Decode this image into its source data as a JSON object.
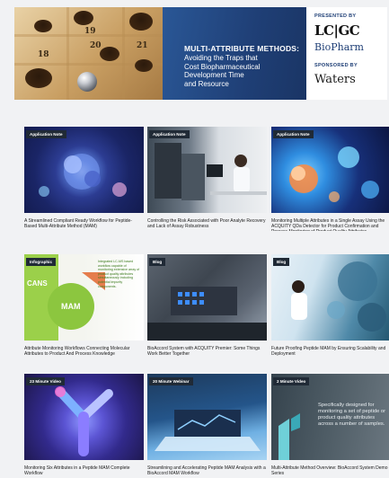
{
  "banner": {
    "title": "MULTI-ATTRIBUTE METHODS:",
    "subtitle_lines": [
      "Avoiding the Traps that",
      "Cost Biopharmaceutical",
      "Development Time",
      "and Resource"
    ],
    "presented_by": "PRESENTED BY",
    "logo_lcgc": "LC|GC",
    "logo_biopharm": "BioPharm",
    "sponsored_by": "SPONSORED BY",
    "logo_waters": "Waters",
    "board_numbers": [
      "19",
      "20",
      "21",
      "18"
    ]
  },
  "cards": [
    {
      "badge": "Application Note",
      "caption": "A Streamlined Compliant Ready Workflow for Peptide-Based Multi-Attribute Method (MAM)",
      "icon": "protein-structure-image"
    },
    {
      "badge": "Application Note",
      "caption": "Controlling the Risk Associated with Poor Analyte Recovery and Lack of Assay Robustness",
      "icon": "lab-scientist-image"
    },
    {
      "badge": "Application Note",
      "caption": "Monitoring Multiple Attributes in a Single Assay Using the ACQUITY QDa Detector for Product Confirmation and Process Monitoring of Product Quality Attributes",
      "icon": "molecules-image"
    },
    {
      "badge": "Infographic",
      "caption": "Attribute Monitoring Workflows Connecting Molecular Attributes to Product And Process Knowledge",
      "icon": "mam-infographic-image"
    },
    {
      "badge": "Blog",
      "caption": "BioAccord System with ACQUITY Premier: Some Things Work Better Together",
      "icon": "instrument-image"
    },
    {
      "badge": "Blog",
      "caption": "Future Proofing Peptide MAM by Ensuring Scalability and Deployment",
      "icon": "scientist-cells-image"
    },
    {
      "badge": "23 Minute Video",
      "caption": "Monitoring Six Attributes in a Peptide MAM Complete Workflow",
      "icon": "antibody-image"
    },
    {
      "badge": "20 Minute Webinar",
      "caption": "Streamlining and Accelerating Peptide MAM Analysis with a BioAccord MAM Workflow",
      "icon": "laptop-data-image"
    },
    {
      "badge": "2 Minute Video",
      "caption": "Multi-Attribute Method Overview: BioAccord System Demo Series",
      "icon": "video-slide-image"
    }
  ],
  "infographic": {
    "left_text": "CANS",
    "circle_text": "MAM",
    "bullet_text": "Integrated LC-MS based workflow capable of monitoring extensive array of product quality attributes simultaneously including potential impurity components."
  },
  "video_slide": {
    "text": "Specifically designed for monitoring a set of peptide or product quality attributes across a number of samples."
  },
  "colors": {
    "banner_blue": "#1f3f76",
    "badge_bg": "#202a36",
    "infographic_green": "#8cc63f"
  }
}
